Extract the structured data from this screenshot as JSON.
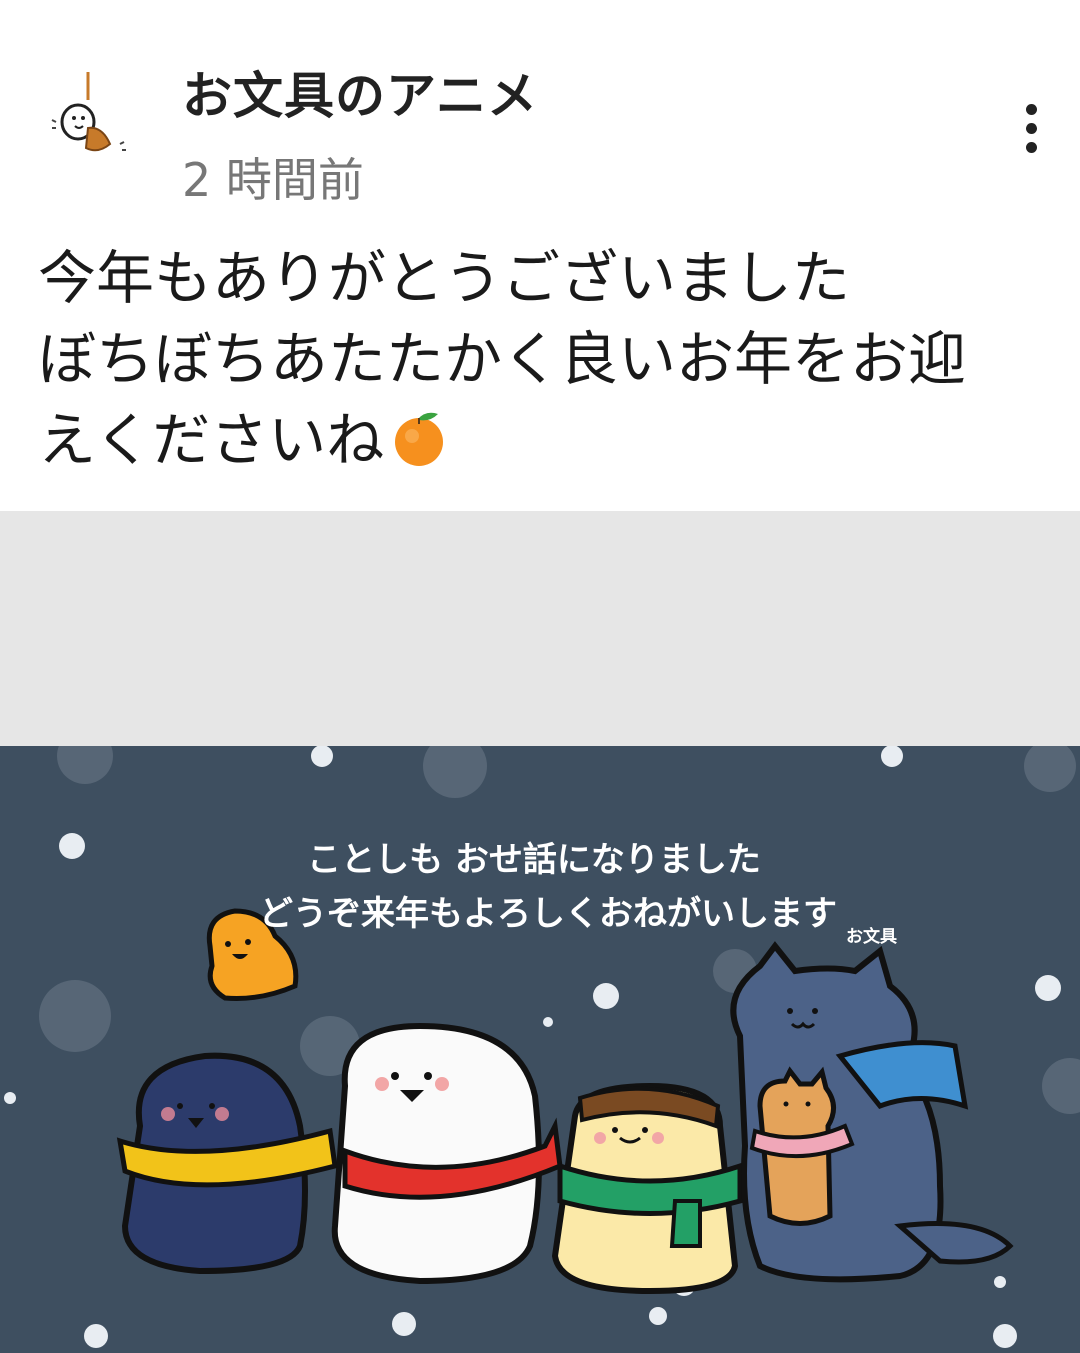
{
  "post": {
    "channel_name": "お文具のアニメ",
    "time": "2 時間前",
    "text_lines": [
      "今年もありがとうございました",
      "ぼちぼちあたたかく良いお年をお迎",
      "えくださいね"
    ],
    "emoji": "tangerine-icon"
  },
  "illustration": {
    "message_line1": "ことしも おせ話になりました",
    "message_line2": "どうぞ来年もよろしくおねがいします",
    "signature": "お文具"
  },
  "colors": {
    "illustration_bg": "#3e4f60",
    "placeholder_gray": "#e6e6e6"
  }
}
